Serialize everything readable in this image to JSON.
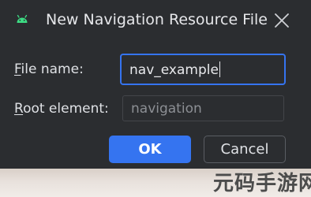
{
  "dialog": {
    "title": "New Navigation Resource File",
    "app_icon": "android-icon",
    "close_icon": "close-icon",
    "file_name": {
      "label_mnemonic": "F",
      "label_rest": "ile name:",
      "value": "nav_example"
    },
    "root_element": {
      "label_mnemonic": "R",
      "label_rest": "oot element:",
      "value": "navigation"
    },
    "buttons": {
      "ok": "OK",
      "cancel": "Cancel"
    }
  },
  "watermark": {
    "text": "元码手游网"
  },
  "colors": {
    "dialog_bg": "#2b2d30",
    "accent": "#3574f0",
    "android_green": "#3ddc84"
  }
}
